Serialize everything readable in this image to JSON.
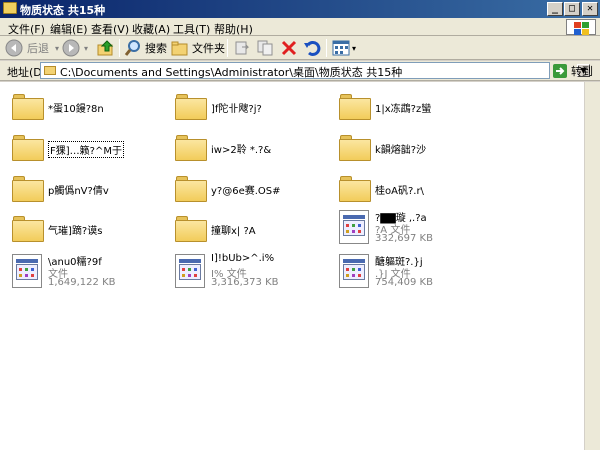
{
  "window": {
    "title": "物质状态 共15种",
    "minimize_glyph": "_",
    "maximize_glyph": "□",
    "close_glyph": "✕"
  },
  "menu": [
    "文件(F)",
    "编辑(E)",
    "查看(V)",
    "收藏(A)",
    "工具(T)",
    "帮助(H)"
  ],
  "toolbar": {
    "back_label": "后退",
    "search_label": "搜索",
    "folders_label": "文件夹"
  },
  "address": {
    "label": "地址(D)",
    "path": "C:\\Documents and Settings\\Administrator\\桌面\\物质状态 共15种",
    "go_label": "转到"
  },
  "folders": [
    {
      "name": "*蛋10鏝?8n"
    },
    {
      "name": "]f陀卝飕?j?"
    },
    {
      "name": "1|x冻鵡?z蠻"
    },
    {
      "name": "F猓]…籁?^M于"
    },
    {
      "name": "iw>2聆 *.?&"
    },
    {
      "name": "k韻熔韷?沙"
    },
    {
      "name": "p觸僞nV?倩v"
    },
    {
      "name": "y?@6e赛.OS#"
    },
    {
      "name": "桂oA矾?.r\\"
    },
    {
      "name": "气璀]蹢?谟s"
    },
    {
      "name": "撞聊x| ?A"
    }
  ],
  "files": [
    {
      "name": "?▇▇璇 ,.?a",
      "type": "?A 文件",
      "size": "332,697 KB"
    },
    {
      "name": "\\anu0糯?9f",
      "type": "文件",
      "size": "1,649,122 KB"
    },
    {
      "name": "I]!bUb>^.i%",
      "type": "I% 文件",
      "size": "3,316,373 KB"
    },
    {
      "name": "醣軀斑?.}j",
      "type": ".}J 文件",
      "size": "754,409 KB"
    }
  ],
  "colors": {
    "titlebar_start": "#0a246a",
    "titlebar_end": "#3a6ea5",
    "delete_red": "#e02020",
    "go_green": "#3a9a3a"
  },
  "icons": [
    "back-icon",
    "forward-icon",
    "up-folder-icon",
    "search-icon",
    "folders-icon",
    "move-to-icon",
    "copy-to-icon",
    "delete-icon",
    "undo-icon",
    "views-icon",
    "folder-icon",
    "file-icon"
  ]
}
